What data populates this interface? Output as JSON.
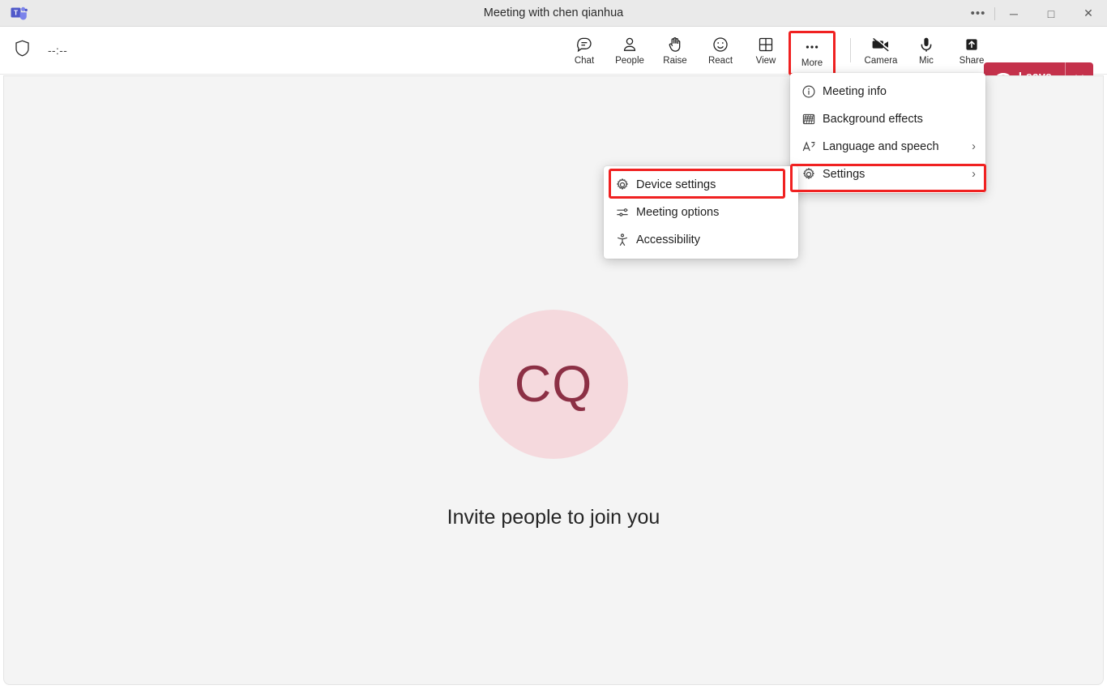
{
  "window": {
    "title": "Meeting with chen qianhua",
    "controls": [
      {
        "name": "more-options",
        "glyph": "•••"
      },
      {
        "name": "minimize",
        "glyph": "─"
      },
      {
        "name": "maximize",
        "glyph": "□"
      },
      {
        "name": "close",
        "glyph": "✕"
      }
    ],
    "app_logo": "teams-logo"
  },
  "actionbar": {
    "shield_icon": "shield-icon",
    "timer": "--:--",
    "tools": [
      {
        "label": "Chat",
        "icon": "chat-icon"
      },
      {
        "label": "People",
        "icon": "people-icon"
      },
      {
        "label": "Raise",
        "icon": "raise-hand-icon"
      },
      {
        "label": "React",
        "icon": "react-smiley-icon"
      },
      {
        "label": "View",
        "icon": "view-grid-icon"
      },
      {
        "label": "More",
        "icon": "more-ellipsis-icon"
      }
    ],
    "device_tools": [
      {
        "label": "Camera",
        "icon": "camera-off-icon"
      },
      {
        "label": "Mic",
        "icon": "mic-icon"
      },
      {
        "label": "Share",
        "icon": "share-up-arrow-icon"
      }
    ],
    "leave": {
      "label": "Leave",
      "icon": "hangup-phone-icon",
      "caret": "chevron-down-icon",
      "color": "#c4314b"
    },
    "active_tool": "More",
    "active_indicator_color": "#5b5fc7"
  },
  "stage": {
    "avatar_initials": "CQ",
    "avatar_bg": "#f5d9dd",
    "avatar_text_color": "#8c3045",
    "invite_text": "Invite people to join you",
    "background": "#f4f4f4"
  },
  "menus": {
    "main": {
      "items": [
        {
          "label": "Meeting info",
          "icon": "info-circle-icon",
          "has_submenu": false,
          "chevron": ""
        },
        {
          "label": "Background effects",
          "icon": "background-effects-icon",
          "has_submenu": false,
          "chevron": ""
        },
        {
          "label": "Language and speech",
          "icon": "language-translate-icon",
          "has_submenu": true,
          "chevron": "›"
        },
        {
          "label": "Settings",
          "icon": "gear-icon",
          "has_submenu": true,
          "chevron": "›"
        }
      ]
    },
    "submenu": {
      "items": [
        {
          "label": "Device settings",
          "icon": "gear-icon",
          "has_submenu": false,
          "chevron": ""
        },
        {
          "label": "Meeting options",
          "icon": "sliders-icon",
          "has_submenu": false,
          "chevron": ""
        },
        {
          "label": "Accessibility",
          "icon": "accessibility-icon",
          "has_submenu": false,
          "chevron": ""
        }
      ]
    }
  },
  "highlights": {
    "color": "#f02121",
    "targets": [
      "More",
      "Settings",
      "Device settings"
    ]
  }
}
